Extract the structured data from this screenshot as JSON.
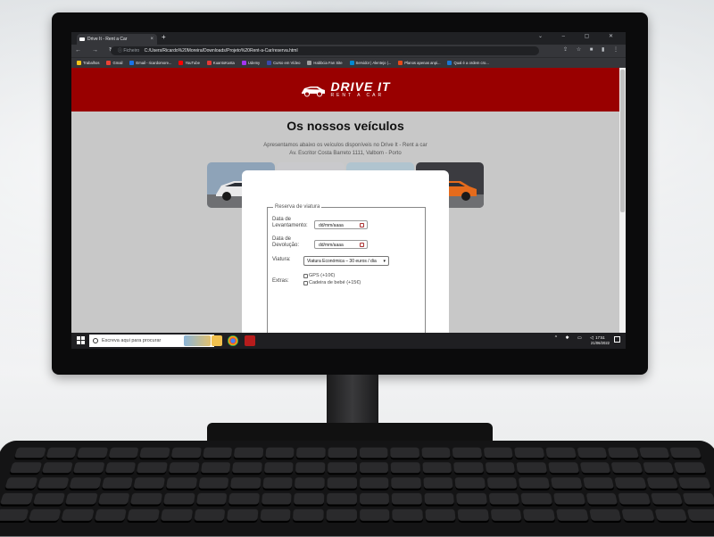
{
  "browser": {
    "tab_title": "Drive It - Rent a Car",
    "tab_close": "×",
    "new_tab": "+",
    "window_controls": "⌄ – ▢ ✕",
    "nav_buttons": "← → ↻",
    "address_label": "ⓘ Ficheiro",
    "address": "C:/Users/Ricardo%20Moreira/Downloads/Projeto%20Rent-a-Car/reserva.html",
    "extensions": "⇪ ☆ ■ ▮ ⋮",
    "bookmarks": [
      {
        "label": "Trabalhos",
        "color": "#f5c518"
      },
      {
        "label": "Gmail",
        "color": "#ea4335"
      },
      {
        "label": "Email - ricardomore...",
        "color": "#1a73e8"
      },
      {
        "label": "YouTube",
        "color": "#ff0000"
      },
      {
        "label": "KuantoKusta",
        "color": "#e53935"
      },
      {
        "label": "Udemy",
        "color": "#a435f0"
      },
      {
        "label": "Curso em Vídeo",
        "color": "#3949ab"
      },
      {
        "label": "Habbcia Fan Site",
        "color": "#9e9e9e"
      },
      {
        "label": "Servidor | Alentejo |...",
        "color": "#0288d1"
      },
      {
        "label": "Planos apenas anpi...",
        "color": "#e64a19"
      },
      {
        "label": "Qual é a ordem cro...",
        "color": "#1976d2"
      }
    ]
  },
  "page": {
    "logo_name": "DRIVE IT",
    "logo_sub": "RENT A CAR",
    "title": "Os nossos veículos",
    "intro_line1": "Apresentamos abaixo os veículos disponíveis no Drive It - Rent a car",
    "intro_line2": "Av. Escritor Costa Barreto 1111, Valbom - Porto",
    "cars": [
      {
        "name": "citroen-white",
        "sky": "#8ea3b8",
        "body": "#e9e9ea"
      },
      {
        "name": "tesla-red",
        "sky": "#c9c9cc",
        "body": "#c01622"
      },
      {
        "name": "suv-blue",
        "sky": "#b0c4cf",
        "body": "#1f5fa3"
      },
      {
        "name": "van-orange",
        "sky": "#3b3b40",
        "body": "#e56b1c"
      }
    ],
    "form": {
      "legend": "Reserva de viatura",
      "pickup_label_1": "Data de",
      "pickup_label_2": "Levantamento:",
      "pickup_value": "dd/mm/aaaa",
      "return_label_1": "Data de",
      "return_label_2": "Devolução:",
      "return_value": "dd/mm/aaaa",
      "vehicle_label": "Viatura:",
      "vehicle_value": "Viatura Económica – 30 euros / dia",
      "extras_label": "Extras:",
      "extra_gps": "GPS (+10€)",
      "extra_seat": "Cadeira de bebé (+15€)"
    }
  },
  "taskbar": {
    "search_placeholder": "Escreva aqui para procurar",
    "tray": "^ ✱ ▭ ◁",
    "time": "17:51",
    "date": "21/06/2022"
  }
}
